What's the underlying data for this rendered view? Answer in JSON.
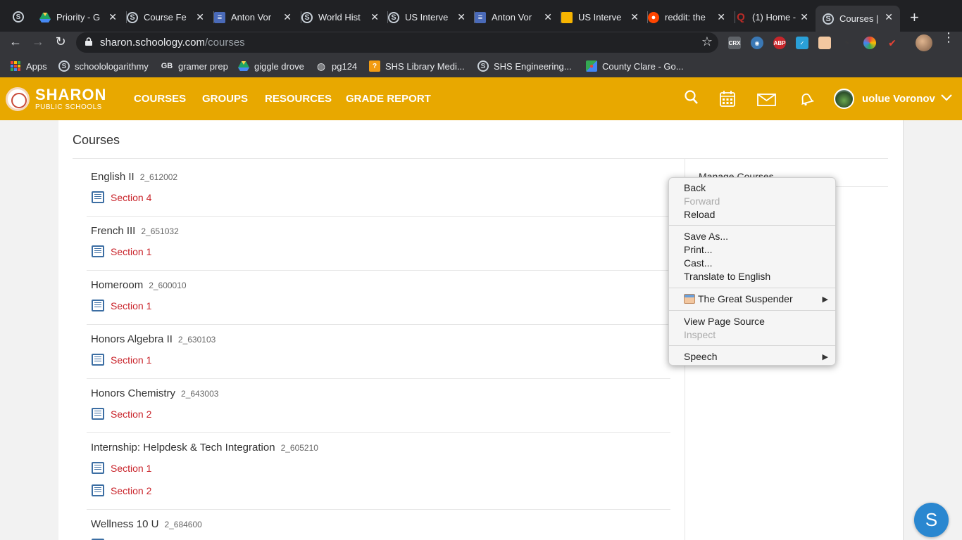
{
  "browser": {
    "tabs": [
      {
        "title": "Priority - G",
        "icon": "google-drive-icon"
      },
      {
        "title": "Course Fe",
        "icon": "schoology-icon"
      },
      {
        "title": "Anton Vor",
        "icon": "google-docs-icon"
      },
      {
        "title": "World Hist",
        "icon": "schoology-icon"
      },
      {
        "title": "US Interve",
        "icon": "schoology-icon"
      },
      {
        "title": "Anton Vor",
        "icon": "google-docs-icon"
      },
      {
        "title": "US Interve",
        "icon": "google-slides-icon"
      },
      {
        "title": "reddit: the",
        "icon": "reddit-icon"
      },
      {
        "title": "(1) Home -",
        "icon": "quora-icon"
      },
      {
        "title": "Courses |",
        "icon": "schoology-icon"
      }
    ],
    "url_host": "sharon.schoology.com",
    "url_path": "/courses",
    "extensions": [
      "CRX",
      "ABP"
    ],
    "bookmarks": [
      {
        "label": "Apps"
      },
      {
        "label": "schoolologarithmy"
      },
      {
        "label": "gramer prep"
      },
      {
        "label": "giggle drove"
      },
      {
        "label": "pg124"
      },
      {
        "label": "SHS Library Medi..."
      },
      {
        "label": "SHS Engineering..."
      },
      {
        "label": "County Clare - Go..."
      }
    ]
  },
  "header": {
    "logo_line1": "SHARON",
    "logo_line2": "PUBLIC SCHOOLS",
    "nav": [
      "COURSES",
      "GROUPS",
      "RESOURCES",
      "GRADE REPORT"
    ],
    "user_name": "uolue Voronov",
    "accent": "#e8a800"
  },
  "page": {
    "title": "Courses",
    "manage_label": "Manage Courses",
    "courses": [
      {
        "name": "English II",
        "code": "2_612002",
        "sections": [
          "Section 4"
        ]
      },
      {
        "name": "French III",
        "code": "2_651032",
        "sections": [
          "Section 1"
        ]
      },
      {
        "name": "Homeroom",
        "code": "2_600010",
        "sections": [
          "Section 1"
        ]
      },
      {
        "name": "Honors Algebra II",
        "code": "2_630103",
        "sections": [
          "Section 1"
        ]
      },
      {
        "name": "Honors Chemistry",
        "code": "2_643003",
        "sections": [
          "Section 2"
        ]
      },
      {
        "name": "Internship: Helpdesk & Tech Integration",
        "code": "2_605210",
        "sections": [
          "Section 1",
          "Section 2"
        ]
      },
      {
        "name": "Wellness 10 U",
        "code": "2_684600",
        "sections": []
      }
    ]
  },
  "context_menu": {
    "back": "Back",
    "forward": "Forward",
    "reload": "Reload",
    "save_as": "Save As...",
    "print": "Print...",
    "cast": "Cast...",
    "translate": "Translate to English",
    "great_suspender": "The Great Suspender",
    "view_source": "View Page Source",
    "inspect": "Inspect",
    "speech": "Speech"
  },
  "chat": {
    "label": "S"
  }
}
